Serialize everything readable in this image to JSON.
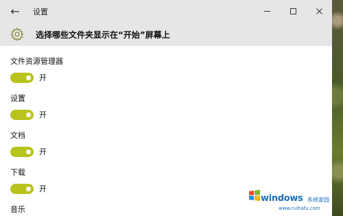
{
  "window": {
    "title": "设置",
    "back_icon": "arrow-left-icon",
    "controls": [
      "minimize-icon",
      "maximize-icon",
      "close-icon"
    ]
  },
  "header": {
    "icon": "gear-icon",
    "title": "选择哪些文件夹显示在“开始”屏幕上"
  },
  "settings": [
    {
      "label": "文件资源管理器",
      "state": "开",
      "on": true
    },
    {
      "label": "设置",
      "state": "开",
      "on": true
    },
    {
      "label": "文档",
      "state": "开",
      "on": true
    },
    {
      "label": "下载",
      "state": "开",
      "on": true
    },
    {
      "label": "音乐"
    }
  ],
  "watermark": {
    "main": "windows",
    "sub": "系统家园",
    "url": "www.ruihafu.com"
  },
  "colors": {
    "toggle_on": "#b8c31d",
    "titlebar": "#e6e6e6",
    "watermark": "#1d6fb8"
  }
}
